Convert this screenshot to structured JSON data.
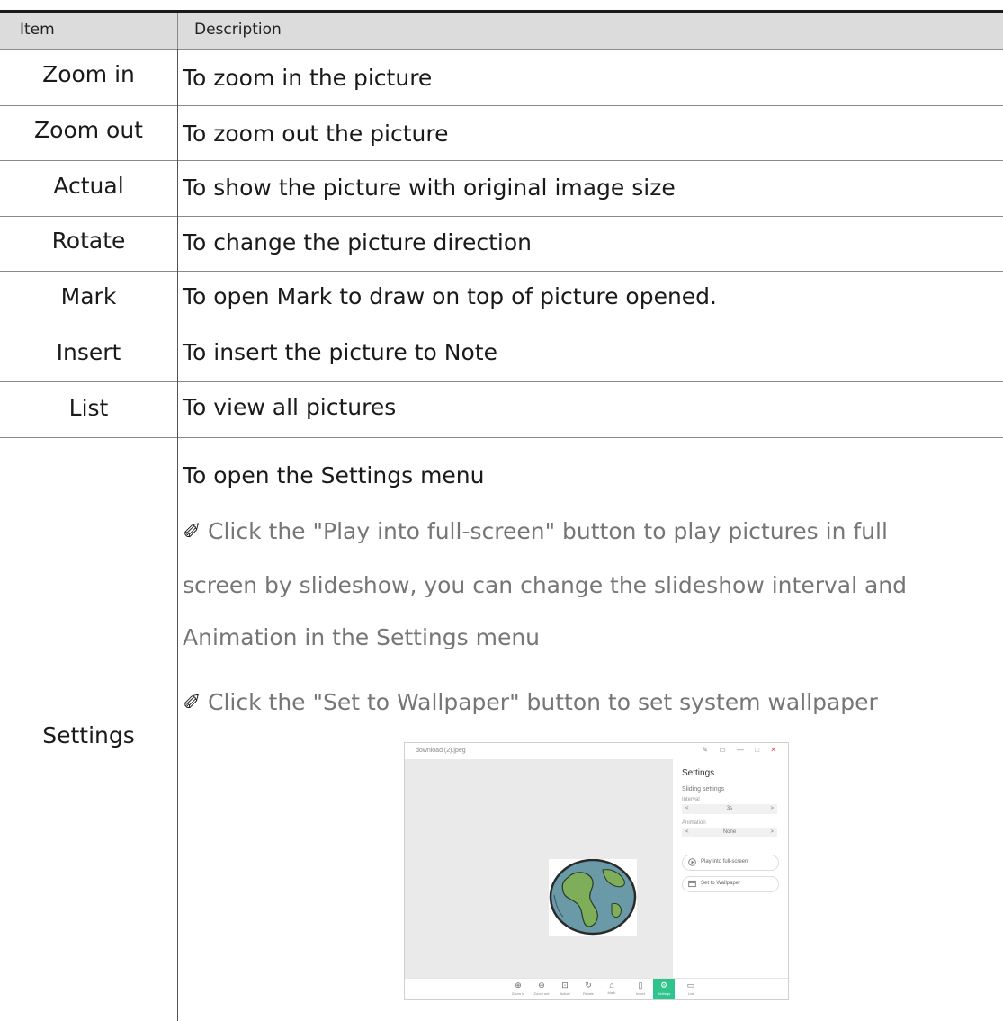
{
  "table": {
    "headers": {
      "item": "Item",
      "description": "Description"
    },
    "rows": [
      {
        "item": "Zoom in",
        "description": "To zoom in the picture"
      },
      {
        "item": "Zoom out",
        "description": "To zoom out the picture"
      },
      {
        "item": "Actual",
        "description": "To show the picture with original image size"
      },
      {
        "item": "Rotate",
        "description": "To change the picture direction"
      },
      {
        "item": "Mark",
        "description": "To open Mark to draw on top of picture opened."
      },
      {
        "item": "Insert",
        "description": "To insert the picture to Note"
      },
      {
        "item": "List",
        "description": "To view all pictures"
      }
    ],
    "settings": {
      "item": "Settings",
      "description": "To open the Settings menu",
      "note1_lines": [
        "Click the \"Play into full-screen\" button to play pictures in full",
        "screen by slideshow, you can change the slideshow interval and",
        "Animation in the Settings menu"
      ],
      "note2": "Click the \"Set to Wallpaper\" button to set system wallpaper",
      "pencil_glyph": "✐"
    }
  },
  "screenshot": {
    "window_title": "download (2).jpeg",
    "window_controls": [
      "✎",
      "▭",
      "—",
      "□",
      "✕"
    ],
    "panel": {
      "title": "Settings",
      "subtitle": "Sliding settings",
      "interval_label": "Interval",
      "interval_value": "3s",
      "animation_label": "Animation",
      "animation_value": "None",
      "prev_glyph": "<",
      "next_glyph": ">",
      "play_button": "Play into full-screen",
      "wallpaper_button": "Set to Wallpaper"
    },
    "toolbar": [
      {
        "glyph": "⊕",
        "label": "Zoom in"
      },
      {
        "glyph": "⊖",
        "label": "Zoom out"
      },
      {
        "glyph": "⊡",
        "label": "Actual"
      },
      {
        "glyph": "↻",
        "label": "Rotate"
      },
      {
        "glyph": "⌂",
        "label": "Mark"
      },
      {
        "glyph": "▯",
        "label": "Insert"
      },
      {
        "glyph": "⚙",
        "label": "Settings",
        "active": true
      },
      {
        "glyph": "▭",
        "label": "List"
      }
    ],
    "accent_color": "#2ec48c"
  }
}
